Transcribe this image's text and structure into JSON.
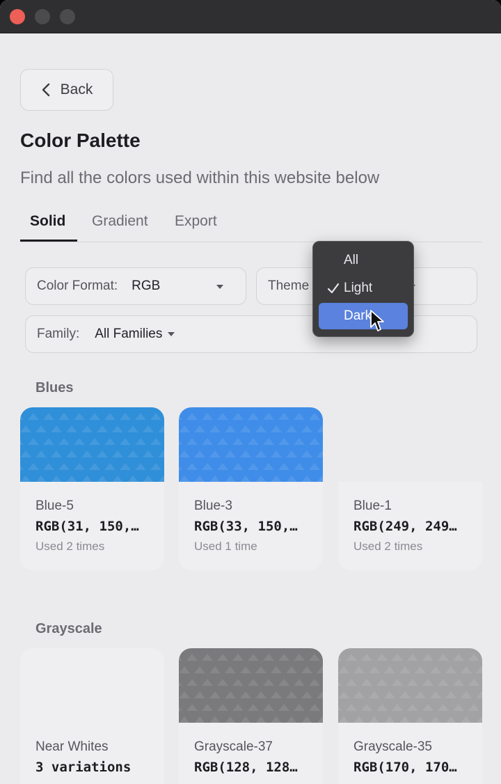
{
  "window": {
    "controls": [
      "close",
      "minimize",
      "maximize"
    ]
  },
  "back_button": {
    "label": "Back",
    "icon": "chevron-left-icon"
  },
  "page": {
    "title": "Color Palette",
    "subtitle": "Find all the colors used within this website below"
  },
  "tabs": [
    {
      "label": "Solid",
      "active": true
    },
    {
      "label": "Gradient",
      "active": false
    },
    {
      "label": "Export",
      "active": false
    }
  ],
  "filters": {
    "color_format": {
      "label": "Color Format:",
      "value": "RGB"
    },
    "theme": {
      "label": "Theme"
    },
    "family": {
      "label": "Family:",
      "value": "All Families"
    }
  },
  "theme_dropdown": {
    "options": [
      {
        "label": "All",
        "checked": false,
        "highlighted": false
      },
      {
        "label": "Light",
        "checked": true,
        "highlighted": false
      },
      {
        "label": "Dark",
        "checked": false,
        "highlighted": true
      }
    ]
  },
  "sections": [
    {
      "title": "Blues",
      "cards": [
        {
          "name": "Blue-5",
          "value": "RGB(31, 150,…",
          "usage": "Used 2 times",
          "color": "#2f8fd8"
        },
        {
          "name": "Blue-3",
          "value": "RGB(33, 150,…",
          "usage": "Used 1 time",
          "color": "#3f8de8"
        },
        {
          "name": "Blue-1",
          "value": "RGB(249, 249…",
          "usage": "Used 2 times",
          "color": "#ebebee"
        }
      ]
    },
    {
      "title": "Grayscale",
      "cards": [
        {
          "name": "Near Whites",
          "value": "3 variations",
          "usage": "",
          "color": "#efeff1"
        },
        {
          "name": "Grayscale-37",
          "value": "RGB(128, 128…",
          "usage": "",
          "color": "#7a7a7d"
        },
        {
          "name": "Grayscale-35",
          "value": "RGB(170, 170…",
          "usage": "",
          "color": "#a2a2a5"
        }
      ]
    }
  ],
  "colors": {
    "titlebar": "#2f2f31",
    "background": "#ebebed",
    "dropdown_bg": "#3c3c3f",
    "highlight": "#5a82de",
    "close": "#ed5f57"
  }
}
